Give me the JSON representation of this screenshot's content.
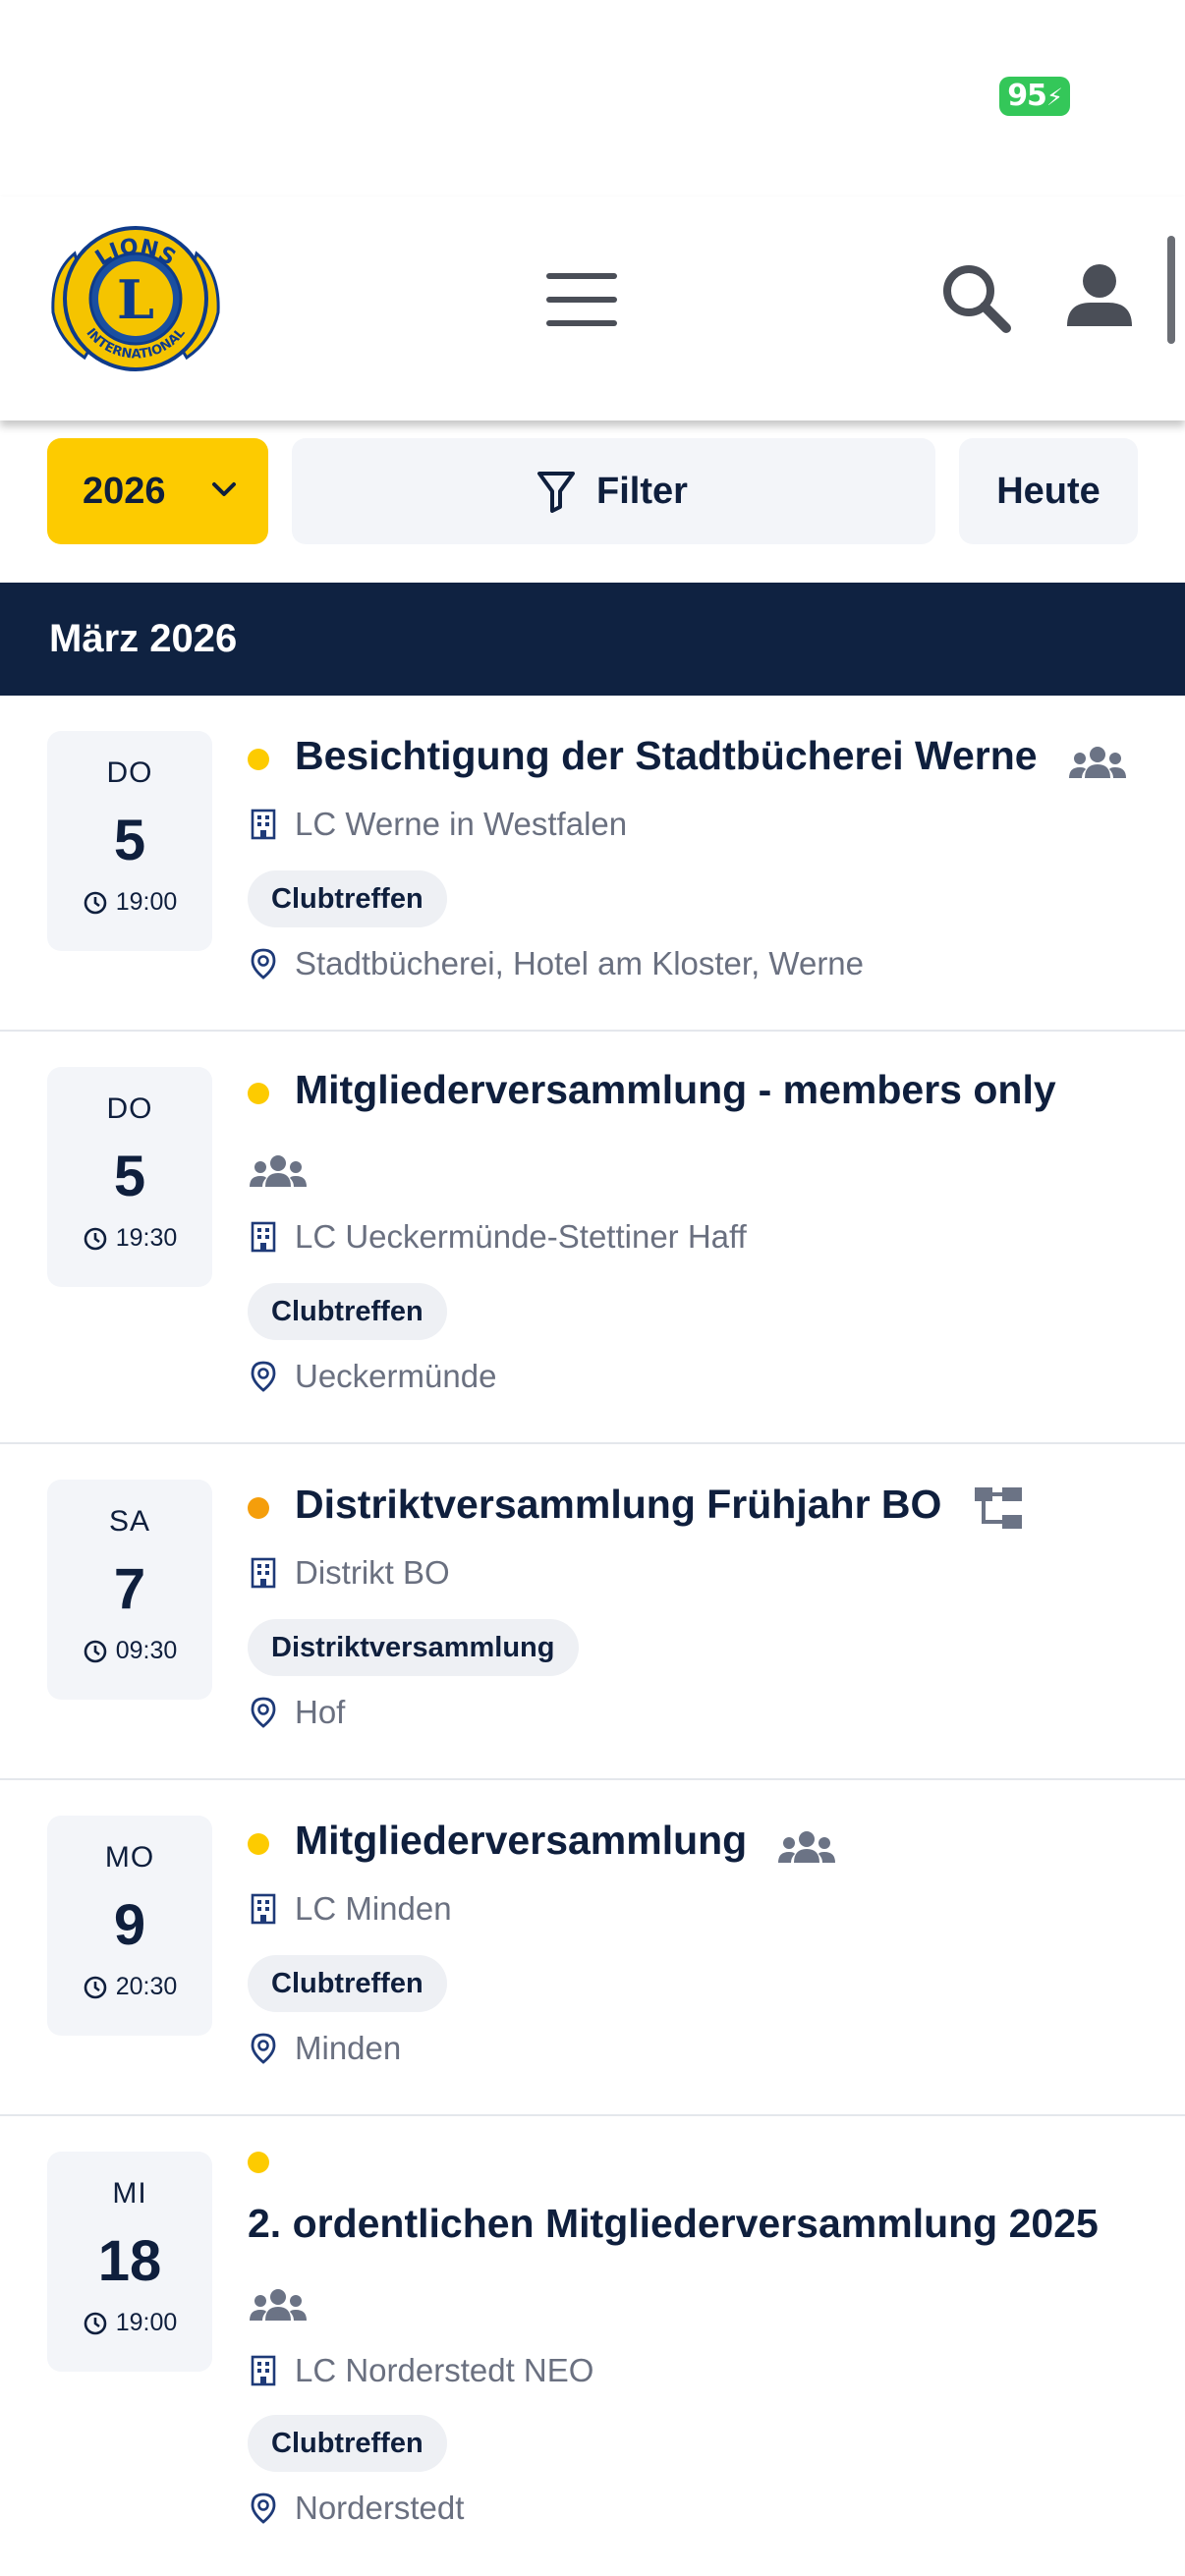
{
  "status": {
    "battery": "95"
  },
  "header": {
    "logo_text_top": "LIONS",
    "logo_letter": "L",
    "logo_text_bottom": "INTERNATIONAL"
  },
  "toolbar": {
    "year": "2026",
    "filter_label": "Filter",
    "today_label": "Heute"
  },
  "month": {
    "label": "März 2026"
  },
  "colors": {
    "accent": "#fdcb00",
    "navy": "#0f2241",
    "dot_club": "#fdcb00",
    "dot_district": "#f59e0b"
  },
  "events": [
    {
      "dow": "DO",
      "day": "5",
      "time": "19:00",
      "title": "Besichtigung der Stadtbücherei Werne",
      "club": "LC Werne in Westfalen",
      "tag": "Clubtreffen",
      "location": "Stadtbücherei, Hotel am Kloster, Werne",
      "icon": "members-icon"
    },
    {
      "dow": "DO",
      "day": "5",
      "time": "19:30",
      "title": "Mitgliederversammlung - members only",
      "club": "LC Ueckermünde-Stettiner Haff",
      "tag": "Clubtreffen",
      "location": "Ueckermünde",
      "icon": "members-icon"
    },
    {
      "dow": "SA",
      "day": "7",
      "time": "09:30",
      "title": "Distriktversammlung Frühjahr BO",
      "club": "Distrikt BO",
      "tag": "Distriktversammlung",
      "location": "Hof",
      "icon": "district-icon"
    },
    {
      "dow": "MO",
      "day": "9",
      "time": "20:30",
      "title": "Mitgliederversammlung",
      "club": "LC Minden",
      "tag": "Clubtreffen",
      "location": "Minden",
      "icon": "members-icon"
    },
    {
      "dow": "MI",
      "day": "18",
      "time": "19:00",
      "title": "2. ordentlichen Mitgliederversammlung 2025",
      "club": "LC Norderstedt NEO",
      "tag": "Clubtreffen",
      "location": "Norderstedt",
      "icon": "members-icon"
    }
  ]
}
